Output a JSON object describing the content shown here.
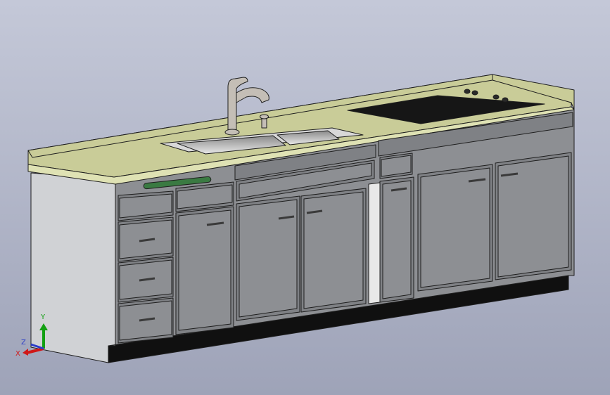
{
  "viewport": {
    "background_top": "#c4c8d8",
    "background_bottom": "#9ea3b8"
  },
  "model": {
    "countertop_color": "#c9cc98",
    "countertop_edge_color": "#dfe2b4",
    "cabinet_face_color": "#8d8f93",
    "cabinet_side_color": "#d0d2d5",
    "panel_color": "#7f8185",
    "handle_color": "#3a3a3a",
    "towel_bar_color": "#3a7a42",
    "cooktop_color": "#161616",
    "faucet_color": "#c4beb6",
    "toe_kick_color": "#101010"
  },
  "triad": {
    "y_label": "Y",
    "z_label": "Z",
    "x_label": "X",
    "y_color": "#12a012",
    "z_color": "#2a3cc8",
    "x_color": "#d01818"
  }
}
